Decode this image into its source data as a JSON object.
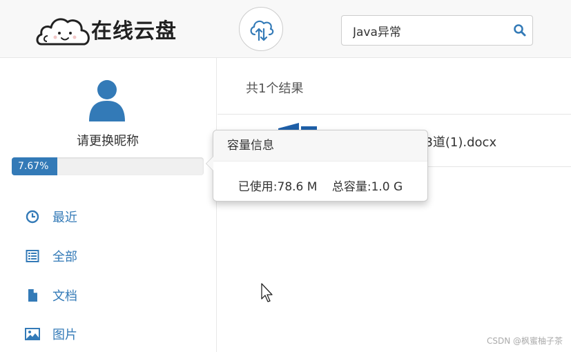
{
  "header": {
    "title": "在线云盘",
    "search": {
      "value": "Java异常",
      "placeholder": ""
    }
  },
  "sidebar": {
    "nickname": "请更换昵称",
    "usage_percent_label": "7.67%",
    "usage_fraction": 0.0767,
    "nav": [
      {
        "label": "最近",
        "icon": "clock-icon"
      },
      {
        "label": "全部",
        "icon": "list-icon"
      },
      {
        "label": "文档",
        "icon": "document-icon"
      },
      {
        "label": "图片",
        "icon": "image-icon"
      }
    ]
  },
  "main": {
    "result_count": "共1个结果",
    "files": [
      {
        "name": "33道(1).docx",
        "icon": "word-file-icon"
      }
    ]
  },
  "popover": {
    "title": "容量信息",
    "used": "已使用:78.6 M",
    "total": "总容量:1.0 G"
  },
  "watermark": "CSDN @枫蜜柚子茶",
  "colors": {
    "accent": "#337ab7",
    "header_bg": "#f8f8f8"
  }
}
